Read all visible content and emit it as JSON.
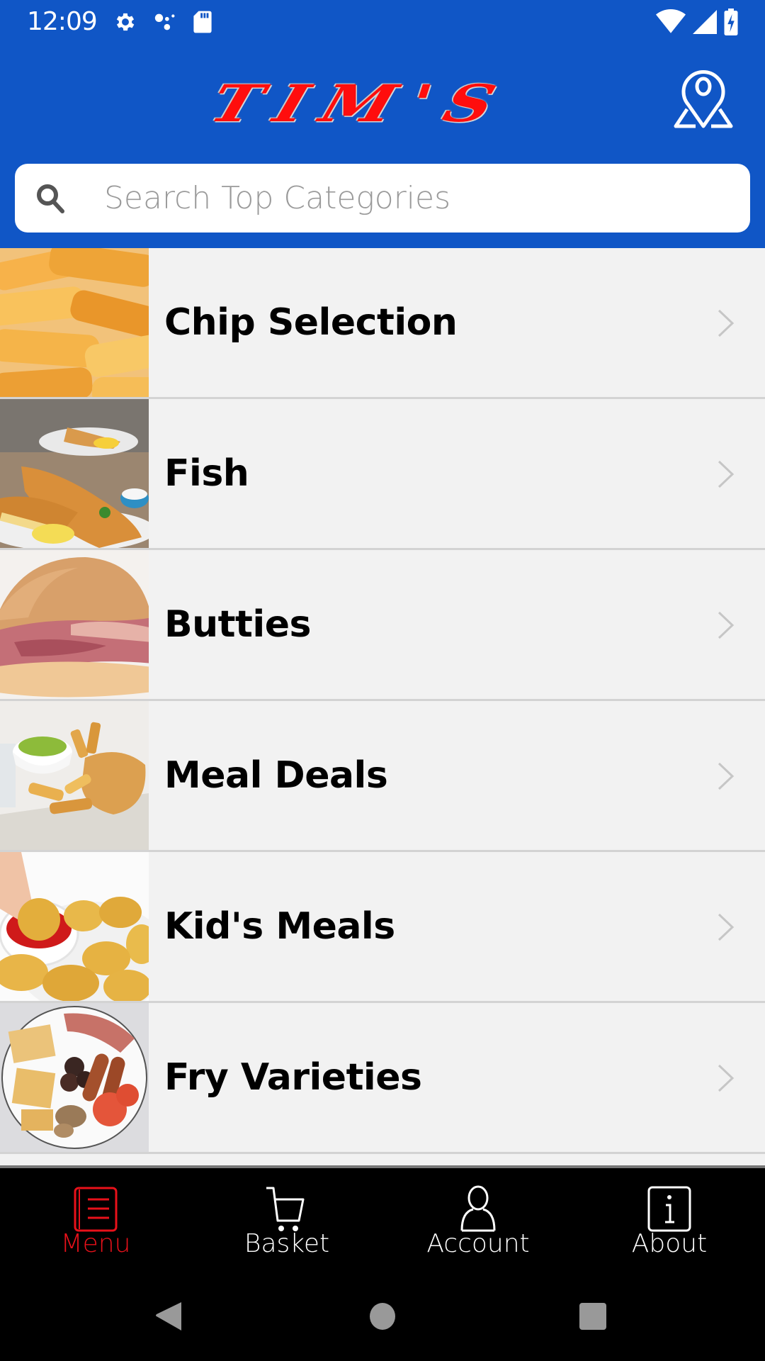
{
  "status_bar": {
    "time": "12:09",
    "left_icons": [
      "settings-icon",
      "assistant-dots-icon",
      "sd-card-icon"
    ],
    "right_icons": [
      "wifi-icon",
      "cellular-signal-icon",
      "battery-charging-icon"
    ]
  },
  "header": {
    "logo_text": "TIM'S",
    "map_button": "location-map-icon",
    "colors": {
      "header_bg": "#1056c6",
      "logo_red": "#ff0d0d"
    }
  },
  "search": {
    "placeholder": "Search Top Categories",
    "value": "",
    "icon": "search-icon"
  },
  "categories": [
    {
      "label": "Chip Selection",
      "image": "chips-photo"
    },
    {
      "label": "Fish",
      "image": "fish-and-chips-photo"
    },
    {
      "label": "Butties",
      "image": "bacon-butty-photo"
    },
    {
      "label": "Meal Deals",
      "image": "fish-meal-deal-photo"
    },
    {
      "label": "Kid's Meals",
      "image": "chicken-nuggets-photo"
    },
    {
      "label": "Fry Varieties",
      "image": "fry-up-breakfast-photo"
    }
  ],
  "tab_bar": {
    "active_color": "#e8111a",
    "tabs": [
      {
        "label": "Menu",
        "icon": "menu-list-icon",
        "active": true
      },
      {
        "label": "Basket",
        "icon": "shopping-cart-icon",
        "active": false
      },
      {
        "label": "Account",
        "icon": "user-icon",
        "active": false
      },
      {
        "label": "About",
        "icon": "info-icon",
        "active": false
      }
    ]
  },
  "nav_bar": {
    "buttons": [
      "back",
      "home",
      "recents"
    ]
  }
}
